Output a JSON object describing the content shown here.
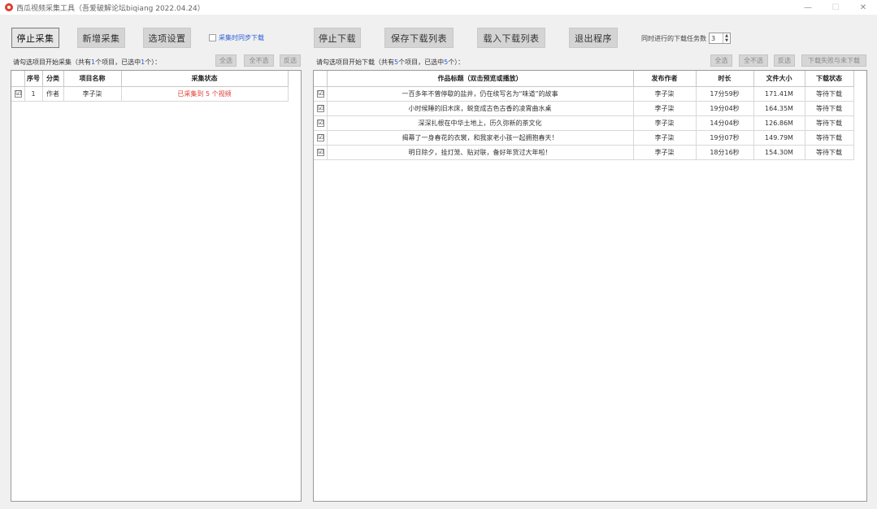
{
  "window": {
    "title": "西瓜视频采集工具（吾爱破解论坛biqiang 2022.04.24）",
    "controls": {
      "minimize": "—",
      "maximize": "☐",
      "close": "✕"
    }
  },
  "toolbar": {
    "stop_collect": "停止采集",
    "add_collect": "新增采集",
    "options": "选项设置",
    "sync_download_label": "采集时同步下载",
    "stop_download": "停止下载",
    "save_list": "保存下载列表",
    "load_list": "载入下载列表",
    "exit": "退出程序",
    "concurrent_label": "同时进行的下载任务数",
    "concurrent_value": "3"
  },
  "left": {
    "info_prefix": "请勾选项目开始采集（共有",
    "total": "1",
    "info_mid": "个项目，已选中",
    "selected": "1",
    "info_suffix": "个）：",
    "select_all": "全选",
    "select_none": "全不选",
    "invert": "反选",
    "columns": [
      "序号",
      "分类",
      "项目名称",
      "采集状态"
    ],
    "rows": [
      {
        "index": "1",
        "category": "作者",
        "name": "李子柒",
        "status": "已采集到 5 个视频"
      }
    ]
  },
  "right": {
    "info_prefix": "请勾选项目开始下载（共有",
    "total": "5",
    "info_mid": "个项目，已选中",
    "selected": "5",
    "info_suffix": "个）：",
    "select_all": "全选",
    "select_none": "全不选",
    "invert": "反选",
    "download_failed": "下载失败与未下载",
    "columns": [
      "作品标题（双击预览或播放）",
      "发布作者",
      "时长",
      "文件大小",
      "下载状态"
    ],
    "rows": [
      {
        "title": "一百多年不曾停歇的盐井，仍在续写名为“味道”的故事",
        "author": "李子柒",
        "duration": "17分59秒",
        "size": "171.41M",
        "status": "等待下载"
      },
      {
        "title": "小时候睡的旧木床，蜕变成古色古香的凌霄曲水桌",
        "author": "李子柒",
        "duration": "19分04秒",
        "size": "164.35M",
        "status": "等待下载"
      },
      {
        "title": "深深扎根在中华土地上，历久弥新的茶文化",
        "author": "李子柒",
        "duration": "14分04秒",
        "size": "126.86M",
        "status": "等待下载"
      },
      {
        "title": "揭幕了一身春花的衣裳，和我家老小孩一起拥抱春天！",
        "author": "李子柒",
        "duration": "19分07秒",
        "size": "149.79M",
        "status": "等待下载"
      },
      {
        "title": "明日除夕，挂灯笼、贴对联，备好年货过大年啦！",
        "author": "李子柒",
        "duration": "18分16秒",
        "size": "154.30M",
        "status": "等待下载"
      }
    ]
  },
  "colors": {
    "accent_blue": "#1f5bd8",
    "status_red": "#e03c31",
    "icon_red": "#e03c31"
  },
  "icons": {
    "checkbox_checked": "☑",
    "spin_up": "▲",
    "spin_down": "▼"
  }
}
